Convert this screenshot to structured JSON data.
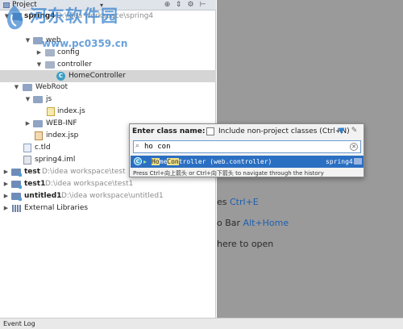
{
  "panel": {
    "title": "Project",
    "caret": "▾",
    "icons": [
      "target-icon",
      "collapse-icon",
      "settings-icon",
      "hide-icon"
    ],
    "icon_glyphs": [
      "⊕",
      "⇕",
      "⚙",
      "⊢"
    ]
  },
  "tree": [
    {
      "label": "spring4",
      "path": "D:\\idea workspace\\spring4",
      "kind": "module",
      "expanded": true
    },
    {
      "label": "web",
      "kind": "folder",
      "expanded": true
    },
    {
      "label": "config",
      "kind": "package",
      "expanded": false
    },
    {
      "label": "controller",
      "kind": "package",
      "expanded": true
    },
    {
      "label": "HomeController",
      "kind": "class",
      "selected": true
    },
    {
      "label": "WebRoot",
      "kind": "folder",
      "expanded": true
    },
    {
      "label": "js",
      "kind": "folder",
      "expanded": true
    },
    {
      "label": "index.js",
      "kind": "js"
    },
    {
      "label": "WEB-INF",
      "kind": "folder",
      "expanded": false
    },
    {
      "label": "index.jsp",
      "kind": "jsp"
    },
    {
      "label": "c.tld",
      "kind": "tld"
    },
    {
      "label": "spring4.iml",
      "kind": "iml"
    },
    {
      "label": "test",
      "path": "D:\\idea workspace\\test",
      "kind": "module",
      "expanded": false
    },
    {
      "label": "test1",
      "path": "D:\\idea workspace\\test1",
      "kind": "module",
      "expanded": false
    },
    {
      "label": "untitled1",
      "path": "D:\\idea workspace\\untitled1",
      "kind": "module",
      "expanded": false
    },
    {
      "label": "External Libraries",
      "kind": "libs",
      "expanded": false
    }
  ],
  "editor_hints": [
    {
      "text": "es ",
      "shortcut": "Ctrl+E"
    },
    {
      "text": "o Bar ",
      "shortcut": "Alt+Home"
    },
    {
      "text": "here to open",
      "shortcut": ""
    }
  ],
  "popup": {
    "title": "Enter class name:",
    "checkbox_label": "Include non-project classes (Ctrl+N)",
    "checkbox_checked": false,
    "search_value": "ho con",
    "result": {
      "name_hl1": "Ho",
      "name_mid": "me",
      "name_hl2": "Con",
      "name_rest": "troller",
      "package": "(web.controller)",
      "module": "spring4"
    },
    "hint": "Press Ctrl+向上箭头 or Ctrl+向下箭头 to navigate through the history"
  },
  "status_bar": {
    "label": "Event Log"
  },
  "watermark": {
    "title": "河东软件园",
    "url": "www.pc0359.cn"
  },
  "colors": {
    "selection": "#2b6fc2",
    "highlight": "#f2e28a",
    "editor_bg": "#9a9a9a"
  }
}
